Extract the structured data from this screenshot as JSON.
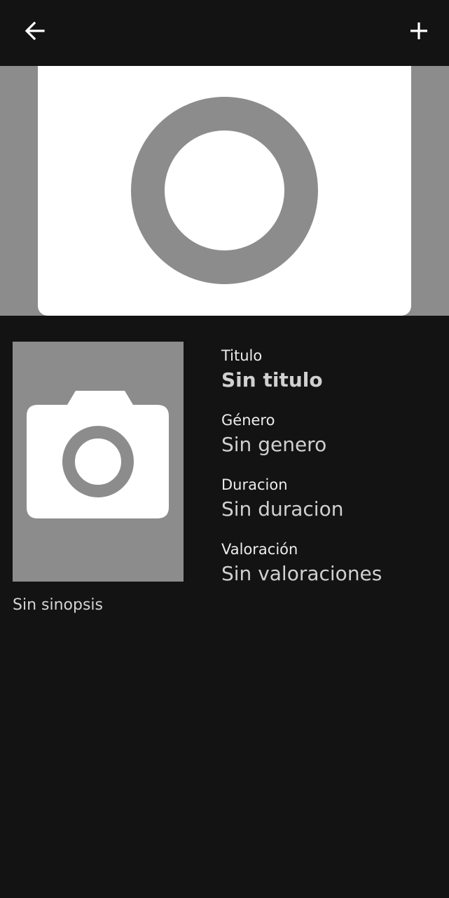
{
  "toolbar": {
    "back_icon": "arrow-left-icon",
    "add_icon": "plus-icon"
  },
  "banner": {
    "image_icon": "placeholder-ring-icon",
    "background": "#8c8c8c",
    "card": "#ffffff"
  },
  "poster": {
    "icon": "camera-icon",
    "background": "#8c8c8c"
  },
  "details": {
    "title_label": "Titulo",
    "title_value": "Sin titulo",
    "genre_label": "Género",
    "genre_value": "Sin genero",
    "duration_label": "Duracion",
    "duration_value": "Sin duracion",
    "rating_label": "Valoración",
    "rating_value": "Sin valoraciones"
  },
  "synopsis": "Sin sinopsis",
  "colors": {
    "background": "#131313",
    "text_primary": "#ececec",
    "text_secondary": "#d0d0d0",
    "placeholder_gray": "#8c8c8c"
  }
}
